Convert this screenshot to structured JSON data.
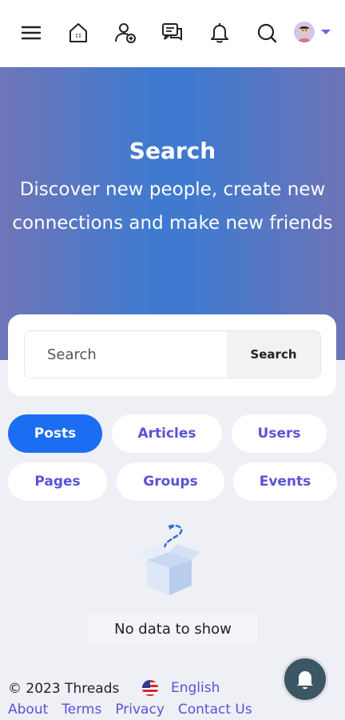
{
  "nav": {
    "icons": [
      "menu-icon",
      "home-icon",
      "add-user-icon",
      "messages-icon",
      "bell-icon",
      "search-icon",
      "avatar",
      "chevron-down-icon"
    ]
  },
  "hero": {
    "title": "Search",
    "subtitle": "Discover new people, create new connections and make new friends"
  },
  "search": {
    "placeholder": "Search",
    "button_label": "Search"
  },
  "filters": [
    {
      "label": "Posts",
      "active": true
    },
    {
      "label": "Articles",
      "active": false
    },
    {
      "label": "Users",
      "active": false
    },
    {
      "label": "Pages",
      "active": false
    },
    {
      "label": "Groups",
      "active": false
    },
    {
      "label": "Events",
      "active": false
    }
  ],
  "empty": {
    "message": "No data to show"
  },
  "footer": {
    "copyright": "© 2023 Threads",
    "language": "English",
    "links": [
      "About",
      "Terms",
      "Privacy",
      "Contact Us"
    ]
  },
  "colors": {
    "accent": "#1b6df2",
    "link": "#5a52d6",
    "fab": "#3c5664"
  }
}
